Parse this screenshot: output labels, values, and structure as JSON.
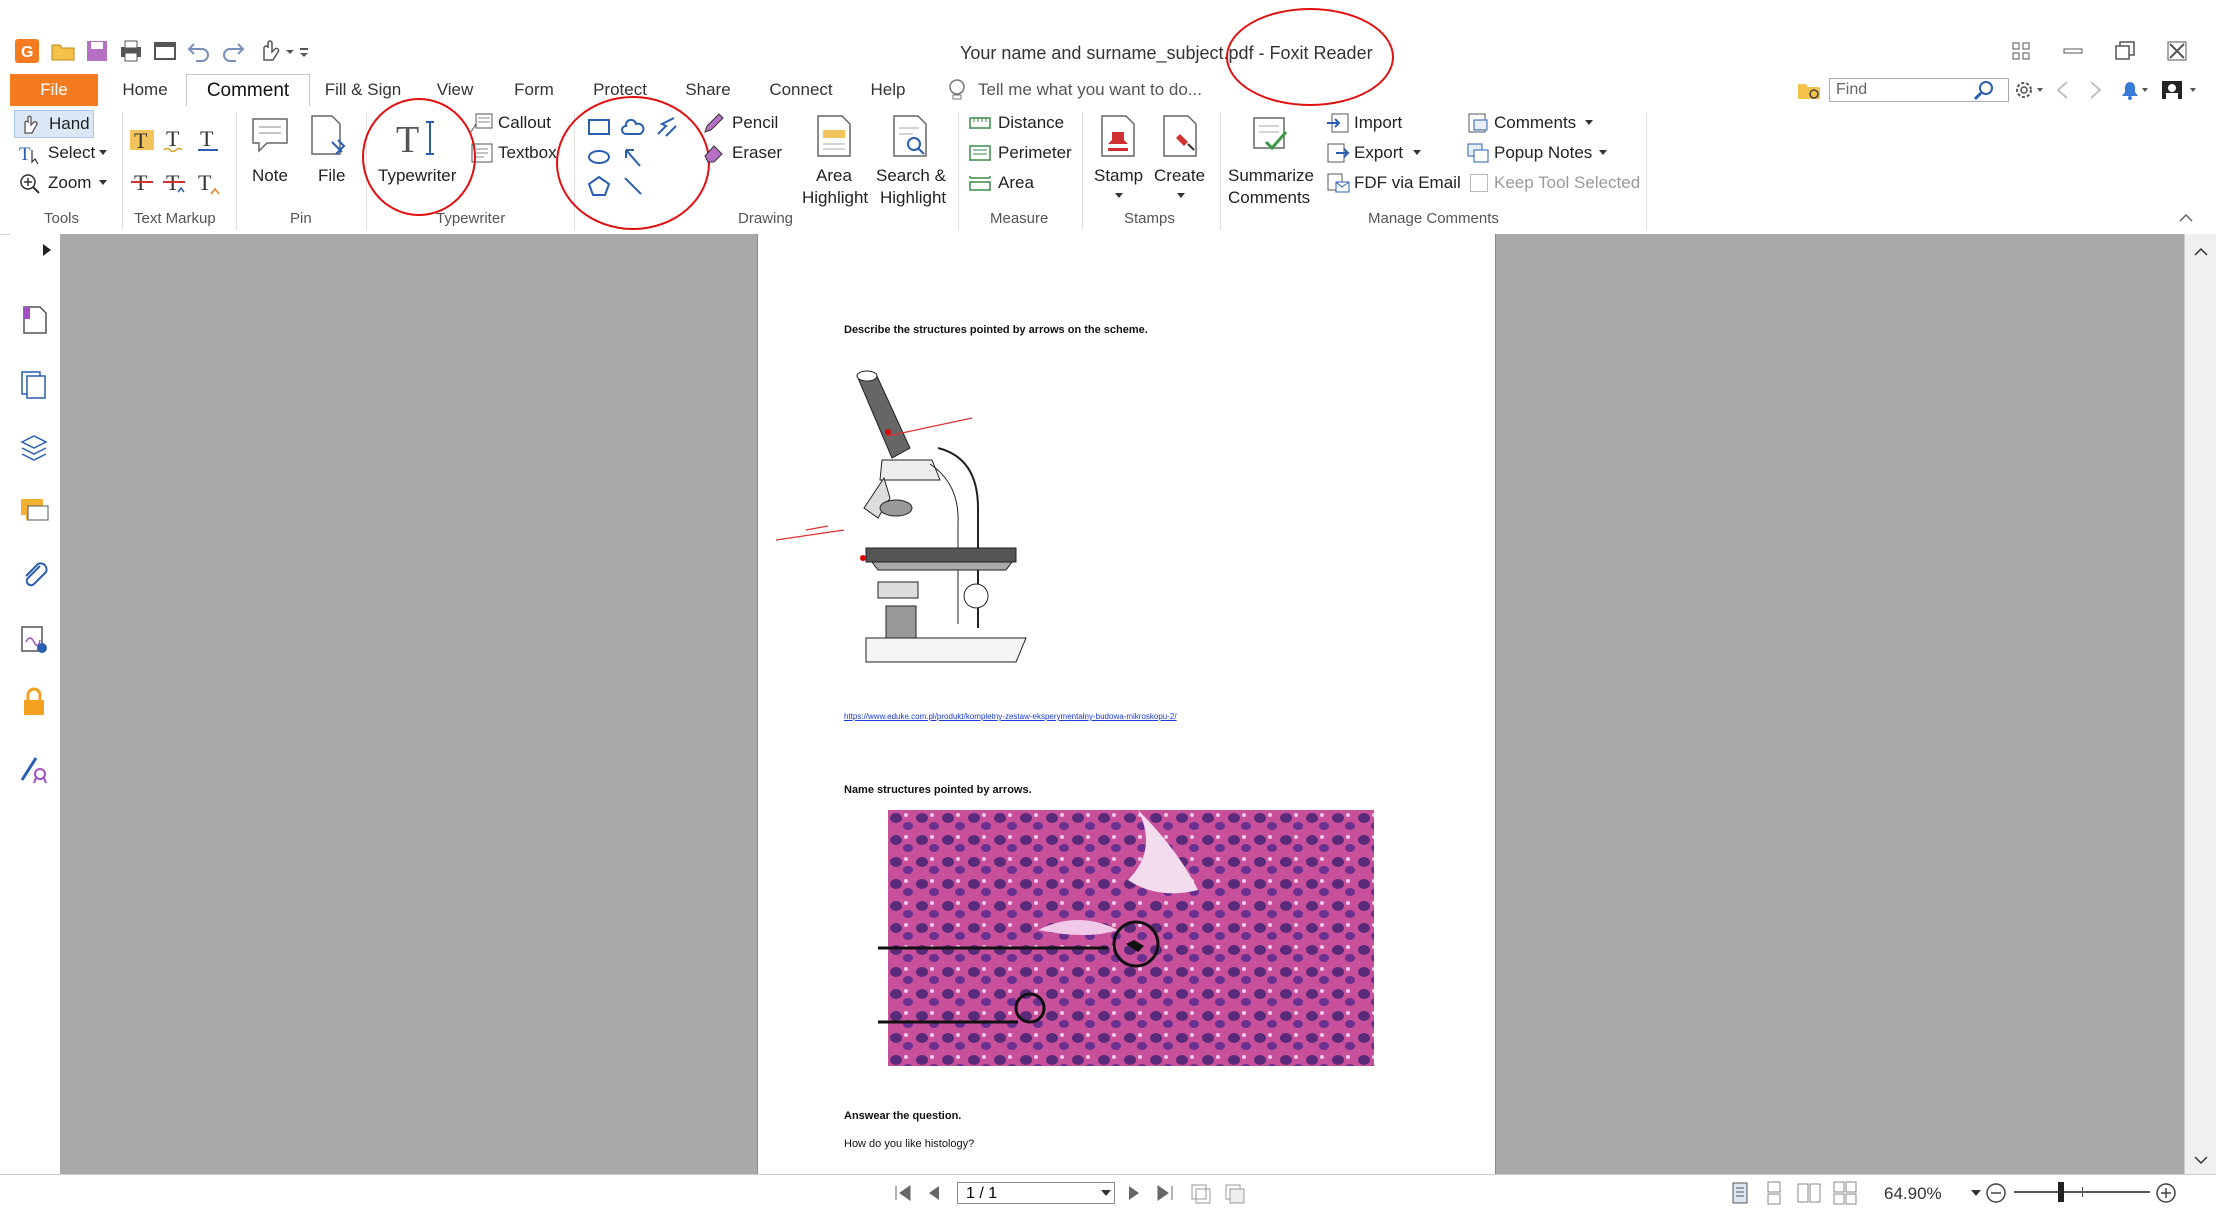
{
  "window": {
    "title": "Your name and surname_subject.pdf - Foxit Reader"
  },
  "menu": {
    "tabs": [
      "File",
      "Home",
      "Comment",
      "Fill & Sign",
      "View",
      "Form",
      "Protect",
      "Share",
      "Connect",
      "Help"
    ],
    "active_tab": "Comment",
    "tell_me_placeholder": "Tell me what you want to do...",
    "find_placeholder": "Find"
  },
  "ribbon": {
    "tools": {
      "hand": "Hand",
      "select": "Select",
      "zoom": "Zoom",
      "group": "Tools"
    },
    "text_markup": {
      "group": "Text Markup"
    },
    "pin": {
      "note": "Note",
      "file": "File",
      "group": "Pin"
    },
    "typewriter": {
      "typewriter": "Typewriter",
      "callout": "Callout",
      "textbox": "Textbox",
      "group": "Typewriter"
    },
    "drawing": {
      "pencil": "Pencil",
      "eraser": "Eraser",
      "area_highlight_1": "Area",
      "area_highlight_2": "Highlight",
      "search_highlight_1": "Search &",
      "search_highlight_2": "Highlight",
      "group": "Drawing"
    },
    "measure": {
      "distance": "Distance",
      "perimeter": "Perimeter",
      "area": "Area",
      "group": "Measure"
    },
    "stamps": {
      "stamp": "Stamp",
      "create": "Create",
      "group": "Stamps"
    },
    "manage_comments": {
      "summarize_1": "Summarize",
      "summarize_2": "Comments",
      "import": "Import",
      "export": "Export",
      "fdf_email": "FDF via Email",
      "comments": "Comments",
      "popup_notes": "Popup Notes",
      "keep_tool": "Keep Tool Selected",
      "group": "Manage Comments"
    }
  },
  "document": {
    "q1": "Describe the structures pointed by arrows on the scheme.",
    "link": "https://www.eduke.com.pl/produkt/kompletny-zestaw-eksperymentalny-budowa-mikroskopu-2/",
    "q2": "Name structures pointed by arrows.",
    "q3": "Answear the question.",
    "q3_body": "How do you like histology?"
  },
  "status": {
    "page": "1 / 1",
    "zoom": "64.90%"
  },
  "colors": {
    "accent": "#f47b20",
    "annotation": "#e01010",
    "canvas": "#a9a9a9",
    "tissue": "#c8509a"
  }
}
